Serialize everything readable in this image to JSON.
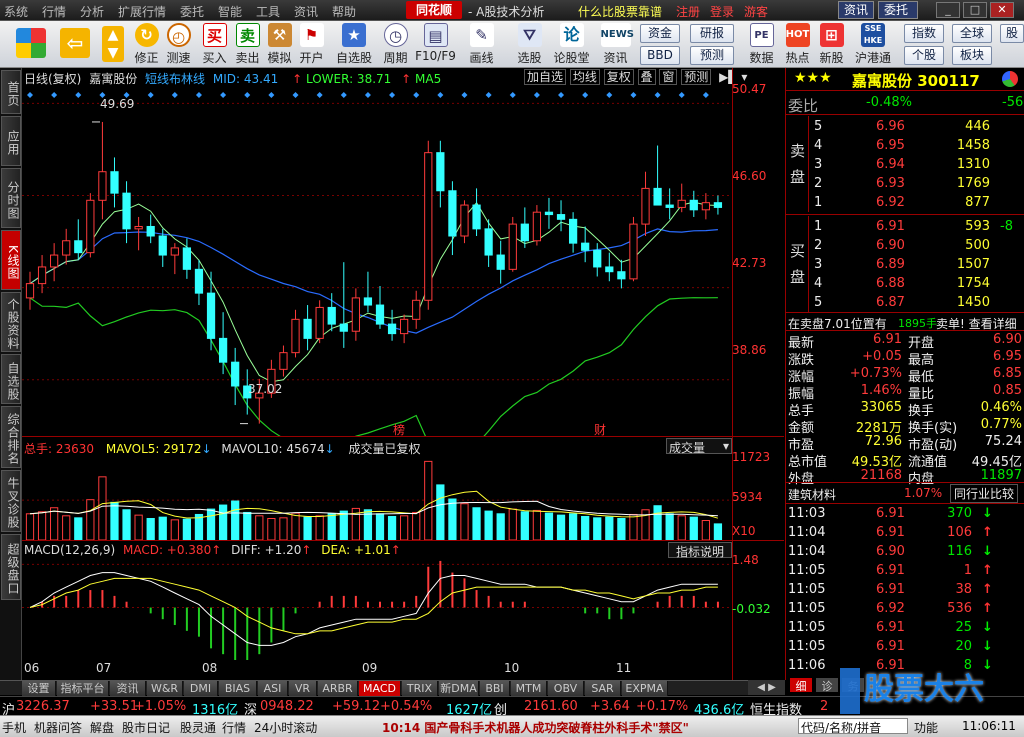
{
  "menu": {
    "items": [
      "系统",
      "行情",
      "分析",
      "扩展行情",
      "委托",
      "智能",
      "工具",
      "资讯",
      "帮助"
    ],
    "brand": "同花顺",
    "title": "- A股技术分析",
    "right_links": [
      "什么比股票靠谱",
      "注册",
      "登录",
      "游客"
    ],
    "buttons": [
      "资讯",
      "委托"
    ],
    "window_buttons": [
      "_",
      "□",
      "✕"
    ]
  },
  "toolbar": {
    "buttons": [
      "修正",
      "测速",
      "买入",
      "卖出",
      "模拟",
      "开户",
      "自选股",
      "周期",
      "F10/F9",
      "画线",
      "选股",
      "论股堂",
      "资讯",
      "数据",
      "热点",
      "新股",
      "沪港通"
    ],
    "small_buttons": [
      "资金",
      "BBD",
      "研报",
      "预测",
      "指数",
      "全球",
      "个股",
      "板块",
      "股"
    ]
  },
  "sidebar": {
    "tabs": [
      "首页",
      "应用",
      "分时图",
      "K线图",
      "个股资料",
      "自选股",
      "综合排名",
      "牛叉诊股",
      "超级盘口"
    ]
  },
  "kline": {
    "header": [
      "日线(复权)",
      "嘉寓股份",
      "短线布林线",
      "MID: 43.41",
      "LOWER: 38.71",
      "MA5"
    ],
    "buttons": [
      "加自选",
      "均线",
      "复权",
      "叠",
      "窗",
      "预测"
    ],
    "y_labels": [
      "50.47",
      "46.60",
      "42.73",
      "38.86"
    ],
    "high_label": "49.69",
    "low_label": "37.02",
    "markers": [
      "榜",
      "财"
    ]
  },
  "volume": {
    "header": [
      "总手: 23630",
      "MAVOL5: 29172",
      "MAVOL10: 45674",
      "成交量已复权"
    ],
    "dropdown": "成交量",
    "y_labels": [
      "11723",
      "5934",
      "X10"
    ]
  },
  "macd": {
    "header": [
      "MACD(12,26,9)",
      "MACD: +0.380",
      "DIFF: +1.20",
      "DEA: +1.01"
    ],
    "button": "指标说明",
    "y_labels": [
      "1.48",
      "-0.032"
    ],
    "x_labels": [
      "06",
      "07",
      "08",
      "09",
      "10",
      "11"
    ]
  },
  "quote": {
    "name": "嘉寓股份",
    "code": "300117",
    "weibi_label": "委比",
    "weibi_value": "-0.48%",
    "weibi_diff": "-56",
    "sell_label": [
      "卖",
      "盘"
    ],
    "buy_label": [
      "买",
      "盘"
    ],
    "asks": [
      {
        "n": "5",
        "price": "6.96",
        "vol": "446"
      },
      {
        "n": "4",
        "price": "6.95",
        "vol": "1458"
      },
      {
        "n": "3",
        "price": "6.94",
        "vol": "1310"
      },
      {
        "n": "2",
        "price": "6.93",
        "vol": "1769"
      },
      {
        "n": "1",
        "price": "6.92",
        "vol": "877"
      }
    ],
    "bids": [
      {
        "n": "1",
        "price": "6.91",
        "vol": "593",
        "chg": "-8"
      },
      {
        "n": "2",
        "price": "6.90",
        "vol": "500",
        "chg": ""
      },
      {
        "n": "3",
        "price": "6.89",
        "vol": "1507",
        "chg": ""
      },
      {
        "n": "4",
        "price": "6.88",
        "vol": "1754",
        "chg": ""
      },
      {
        "n": "5",
        "price": "6.87",
        "vol": "1450",
        "chg": ""
      }
    ],
    "notice": "在卖盘7.01位置有",
    "notice_vol": "1895手",
    "notice_tail": "卖单! 查看详细",
    "stats": [
      [
        "最新",
        "6.91",
        "开盘",
        "6.90"
      ],
      [
        "涨跌",
        "+0.05",
        "最高",
        "6.95"
      ],
      [
        "涨幅",
        "+0.73%",
        "最低",
        "6.85"
      ],
      [
        "振幅",
        "1.46%",
        "量比",
        "0.85"
      ],
      [
        "总手",
        "33065",
        "换手",
        "0.46%"
      ],
      [
        "金额",
        "2281万",
        "换手(实)",
        "0.77%"
      ],
      [
        "市盈",
        "72.96",
        "市盈(动)",
        "75.24"
      ],
      [
        "总市值",
        "49.53亿",
        "流通值",
        "49.45亿"
      ],
      [
        "外盘",
        "21168",
        "内盘",
        "11897"
      ]
    ],
    "industry": "建筑材料",
    "industry_pct": "1.07%",
    "industry_btn": "同行业比较",
    "ticks": [
      [
        "11:03",
        "6.91",
        "370",
        "down"
      ],
      [
        "11:04",
        "6.91",
        "106",
        "up"
      ],
      [
        "11:04",
        "6.90",
        "116",
        "down"
      ],
      [
        "11:05",
        "6.91",
        "1",
        "up"
      ],
      [
        "11:05",
        "6.91",
        "38",
        "up"
      ],
      [
        "11:05",
        "6.92",
        "536",
        "up"
      ],
      [
        "11:05",
        "6.91",
        "25",
        "down"
      ],
      [
        "11:05",
        "6.91",
        "20",
        "down"
      ],
      [
        "11:06",
        "6.91",
        "8",
        "down"
      ]
    ],
    "bottom_tabs": [
      "细",
      "诊",
      "务"
    ]
  },
  "bottom_tabs": [
    "设置",
    "指标平台",
    "资讯",
    "W&R",
    "DMI",
    "BIAS",
    "ASI",
    "VR",
    "ARBR",
    "MACD",
    "TRIX",
    "新DMA",
    "BBI",
    "MTM",
    "OBV",
    "SAR",
    "EXPMA"
  ],
  "ticker": {
    "sh_label": "沪",
    "sh_index": "3226.37",
    "sh_change": "+33.51",
    "sh_pct": "+1.05%",
    "sh_amount": "1316亿",
    "sz_label": "深",
    "sz_index": "0948.22",
    "sz_change": "+59.12",
    "sz_pct": "+0.54%",
    "sz_amount": "1627亿",
    "cy_label": "创",
    "cy_index": "2161.60",
    "cy_change": "+3.64",
    "cy_pct": "+0.17%",
    "cy_amount": "436.6亿",
    "hs_label": "恒生指数",
    "hs_tail": "2",
    "watermark": "股票大六"
  },
  "status": {
    "items": [
      "手机",
      "机器问答",
      "解盘",
      "股市日记",
      "股灵通",
      "行情",
      "24小时滚动"
    ],
    "news": "10:14 国产骨科手术机器人成功突破脊柱外科手术\"禁区\"",
    "code_label": "代码/名称/拼音",
    "func_label": "功能",
    "time": "11:06:11"
  },
  "chart_data": [
    {
      "type": "candlestick",
      "title": "嘉寓股份 日线(复权)",
      "x_ticks": [
        "06",
        "07",
        "08",
        "09",
        "10",
        "11"
      ],
      "ylim": [
        36.5,
        51.2
      ],
      "y_ticks": [
        50.47,
        46.6,
        42.73,
        38.86
      ],
      "high": 49.69,
      "low": 37.02,
      "ohlc": [
        [
          42.3,
          43.4,
          41.8,
          42.9
        ],
        [
          42.9,
          44.1,
          42.5,
          43.6
        ],
        [
          43.6,
          44.6,
          43.0,
          44.1
        ],
        [
          44.1,
          45.2,
          43.7,
          44.7
        ],
        [
          44.7,
          45.6,
          43.9,
          44.2
        ],
        [
          44.2,
          46.7,
          44.0,
          46.4
        ],
        [
          46.4,
          49.69,
          45.6,
          47.6
        ],
        [
          47.6,
          48.2,
          46.1,
          46.7
        ],
        [
          46.7,
          47.2,
          44.6,
          45.2
        ],
        [
          45.2,
          45.7,
          44.3,
          45.3
        ],
        [
          45.3,
          45.8,
          44.6,
          44.9
        ],
        [
          44.9,
          45.2,
          43.6,
          44.1
        ],
        [
          44.1,
          44.6,
          43.3,
          44.4
        ],
        [
          44.4,
          44.8,
          43.1,
          43.5
        ],
        [
          43.5,
          43.9,
          42.0,
          42.5
        ],
        [
          42.5,
          43.4,
          40.1,
          40.6
        ],
        [
          40.6,
          41.7,
          39.1,
          39.6
        ],
        [
          39.6,
          40.2,
          37.8,
          38.6
        ],
        [
          38.6,
          39.3,
          37.4,
          38.1
        ],
        [
          38.1,
          38.9,
          37.02,
          38.3
        ],
        [
          38.3,
          39.7,
          38.1,
          39.3
        ],
        [
          39.3,
          40.3,
          39.0,
          40.0
        ],
        [
          40.0,
          41.8,
          39.8,
          41.4
        ],
        [
          41.4,
          42.0,
          40.1,
          40.6
        ],
        [
          40.6,
          42.2,
          40.4,
          41.9
        ],
        [
          41.9,
          42.5,
          40.9,
          41.2
        ],
        [
          41.2,
          43.8,
          40.2,
          40.9
        ],
        [
          40.9,
          42.7,
          40.5,
          42.3
        ],
        [
          42.3,
          43.4,
          41.7,
          42.0
        ],
        [
          42.0,
          42.8,
          41.0,
          41.2
        ],
        [
          41.2,
          41.8,
          40.5,
          40.8
        ],
        [
          40.8,
          41.6,
          40.4,
          41.4
        ],
        [
          41.4,
          42.6,
          41.0,
          42.2
        ],
        [
          42.2,
          48.9,
          41.8,
          48.4
        ],
        [
          48.4,
          48.9,
          46.1,
          46.8
        ],
        [
          46.8,
          47.2,
          44.1,
          44.9
        ],
        [
          44.9,
          46.4,
          44.6,
          46.2
        ],
        [
          46.2,
          46.9,
          44.9,
          45.2
        ],
        [
          45.2,
          45.6,
          43.6,
          44.1
        ],
        [
          44.1,
          44.7,
          42.9,
          43.5
        ],
        [
          43.5,
          45.7,
          43.4,
          45.4
        ],
        [
          45.4,
          46.1,
          44.4,
          44.7
        ],
        [
          44.7,
          46.2,
          44.5,
          45.9
        ],
        [
          45.9,
          46.5,
          45.2,
          45.8
        ],
        [
          45.8,
          46.4,
          45.1,
          45.6
        ],
        [
          45.6,
          45.9,
          44.2,
          44.6
        ],
        [
          44.6,
          45.3,
          43.8,
          44.3
        ],
        [
          44.3,
          44.6,
          43.2,
          43.6
        ],
        [
          43.6,
          44.2,
          43.0,
          43.4
        ],
        [
          43.4,
          43.9,
          42.7,
          43.1
        ],
        [
          43.1,
          45.7,
          43.0,
          45.4
        ],
        [
          45.4,
          47.6,
          44.9,
          46.9
        ],
        [
          46.9,
          48.7,
          46.5,
          46.2
        ],
        [
          46.2,
          46.9,
          45.6,
          46.1
        ],
        [
          46.1,
          47.1,
          45.9,
          46.4
        ],
        [
          46.4,
          46.8,
          45.7,
          46.0
        ],
        [
          46.0,
          46.7,
          45.6,
          46.3
        ],
        [
          46.3,
          46.6,
          45.8,
          46.1
        ]
      ],
      "volume": [
        3.9,
        4.2,
        4.8,
        3.6,
        3.3,
        6.0,
        9.4,
        5.6,
        4.5,
        3.7,
        3.2,
        3.4,
        3.0,
        3.1,
        3.8,
        4.6,
        5.2,
        5.8,
        4.1,
        3.6,
        3.2,
        3.3,
        4.0,
        3.4,
        3.6,
        3.9,
        4.3,
        4.7,
        4.5,
        3.9,
        3.5,
        3.6,
        4.1,
        11.7,
        8.2,
        6.1,
        5.4,
        4.8,
        4.3,
        3.9,
        4.6,
        4.2,
        4.4,
        4.0,
        3.7,
        3.9,
        3.5,
        3.3,
        3.4,
        3.2,
        3.8,
        4.5,
        5.1,
        3.9,
        3.6,
        3.4,
        2.9,
        2.4
      ],
      "macd": {
        "ylim": [
          -1.8,
          1.7
        ],
        "diff": [
          0.0,
          0.2,
          0.5,
          0.7,
          0.9,
          1.1,
          1.2,
          1.2,
          1.1,
          1.0,
          0.9,
          0.7,
          0.5,
          0.3,
          0.1,
          -0.3,
          -0.6,
          -0.9,
          -1.2,
          -1.3,
          -1.3,
          -1.2,
          -1.0,
          -0.9,
          -0.7,
          -0.6,
          -0.5,
          -0.4,
          -0.4,
          -0.4,
          -0.4,
          -0.3,
          -0.2,
          0.5,
          1.0,
          1.1,
          1.1,
          1.0,
          0.9,
          0.8,
          0.8,
          0.8,
          0.7,
          0.7,
          0.7,
          0.6,
          0.5,
          0.4,
          0.3,
          0.2,
          0.2,
          0.4,
          0.6,
          0.7,
          0.8,
          0.8,
          0.8,
          0.8
        ],
        "dea": [
          0.0,
          0.1,
          0.3,
          0.5,
          0.6,
          0.8,
          0.9,
          1.0,
          1.0,
          1.0,
          1.0,
          0.9,
          0.8,
          0.7,
          0.6,
          0.4,
          0.2,
          0.0,
          -0.3,
          -0.5,
          -0.7,
          -0.8,
          -0.9,
          -0.9,
          -0.8,
          -0.8,
          -0.7,
          -0.6,
          -0.5,
          -0.5,
          -0.5,
          -0.4,
          -0.4,
          -0.2,
          0.2,
          0.5,
          0.6,
          0.7,
          0.7,
          0.7,
          0.7,
          0.7,
          0.7,
          0.7,
          0.7,
          0.6,
          0.6,
          0.5,
          0.5,
          0.4,
          0.3,
          0.4,
          0.5,
          0.5,
          0.6,
          0.6,
          0.7,
          0.7
        ]
      }
    }
  ]
}
